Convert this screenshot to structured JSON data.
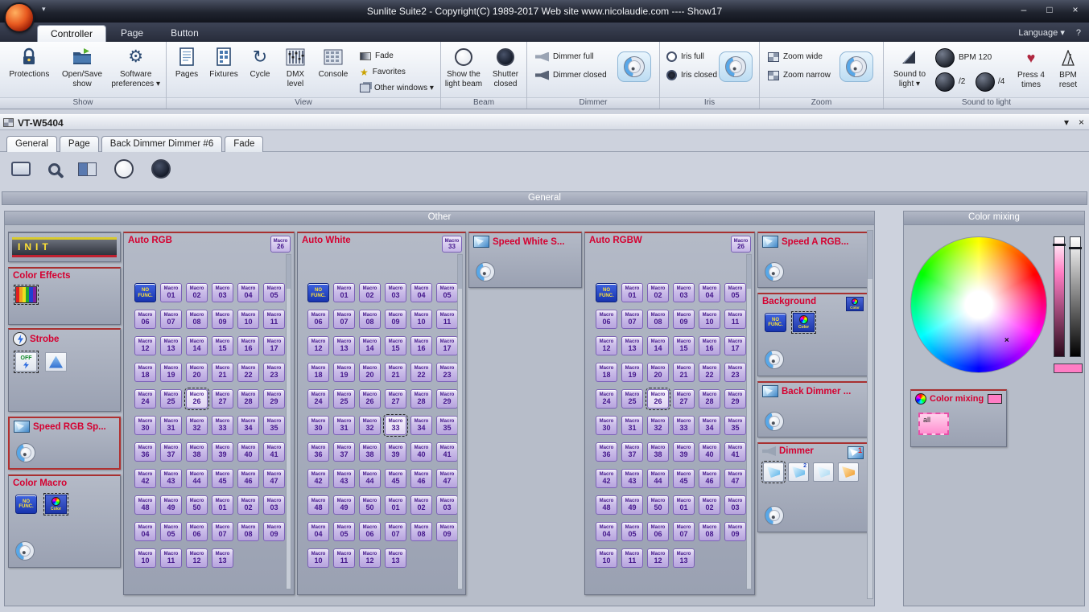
{
  "title_bar": {
    "title": "Sunlite Suite2 - Copyright(C) 1989-2017    Web site www.nicolaudie.com ---- Show17",
    "caret": "▾",
    "controls": {
      "minimize": "–",
      "maximize": "□",
      "close": "×"
    }
  },
  "menu": {
    "tabs": [
      {
        "label": "Controller",
        "active": true
      },
      {
        "label": "Page",
        "active": false
      },
      {
        "label": "Button",
        "active": false
      }
    ],
    "language_label": "Language",
    "language_caret": "▾",
    "help_label": "?"
  },
  "ribbon": {
    "caret": "▾",
    "show": {
      "label": "Show",
      "items": [
        "Protections",
        "Open/Save show",
        "Software preferences"
      ]
    },
    "view": {
      "label": "View",
      "big_items": [
        "Pages",
        "Fixtures",
        "Cycle",
        "DMX level",
        "Console"
      ],
      "stack_items": [
        "Fade",
        "Favorites",
        "Other windows"
      ]
    },
    "beam": {
      "label": "Beam",
      "items": [
        "Show the light beam",
        "Shutter closed"
      ]
    },
    "dimmer": {
      "label": "Dimmer",
      "items": [
        "Dimmer full",
        "Dimmer closed"
      ]
    },
    "iris": {
      "label": "Iris",
      "items": [
        "Iris full",
        "Iris closed"
      ]
    },
    "zoom": {
      "label": "Zoom",
      "items": [
        "Zoom wide",
        "Zoom narrow"
      ]
    },
    "sound": {
      "label": "Sound to light",
      "button": "Sound to light",
      "bpm": "BPM 120",
      "div2": "/2",
      "div4": "/4",
      "press": "Press 4 times",
      "reset": "BPM reset"
    }
  },
  "window": {
    "title": "VT-W5404",
    "controls": {
      "collapse": "▾",
      "close": "×"
    },
    "tabs": [
      "General",
      "Page",
      "Back Dimmer Dimmer #6",
      "Fade"
    ],
    "section_header": "General"
  },
  "other_panel": {
    "title": "Other",
    "init_group": {
      "title": "INIT"
    },
    "color_effects_group": {
      "title": "Color Effects"
    },
    "strobe_group": {
      "title": "Strobe",
      "off_label": "OFF"
    },
    "speed_rgb_group": {
      "title": "Speed RGB Sp..."
    },
    "color_macro_group": {
      "title": "Color Macro",
      "no_func_label": "NO FUNC.",
      "color_label": "Color"
    },
    "speed_white_group": {
      "title": "Speed White S..."
    },
    "speed_a_group": {
      "title": "Speed A RGB..."
    },
    "background_group": {
      "title": "Background",
      "badge": "Color",
      "no_func_label": "NO FUNC.",
      "color_label": "Color"
    },
    "back_dimmer_group": {
      "title": "Back Dimmer ..."
    },
    "dimmer_group": {
      "title": "Dimmer",
      "badge": "1",
      "beam2_label": "2"
    },
    "macro_labels": [
      "NO FUNC.",
      "Macro 01",
      "Macro 02",
      "Macro 03",
      "Macro 04",
      "Macro 05",
      "Macro 06",
      "Macro 07",
      "Macro 08",
      "Macro 09",
      "Macro 10",
      "Macro 11",
      "Macro 12",
      "Macro 13",
      "Macro 14",
      "Macro 15",
      "Macro 16",
      "Macro 17",
      "Macro 18",
      "Macro 19",
      "Macro 20",
      "Macro 21",
      "Macro 22",
      "Macro 23",
      "Macro 24",
      "Macro 25",
      "Macro 26",
      "Macro 27",
      "Macro 28",
      "Macro 29",
      "Macro 30",
      "Macro 31",
      "Macro 32",
      "Macro 33",
      "Macro 34",
      "Macro 35",
      "Macro 36",
      "Macro 37",
      "Macro 38",
      "Macro 39",
      "Macro 40",
      "Macro 41",
      "Macro 42",
      "Macro 43",
      "Macro 44",
      "Macro 45",
      "Macro 46",
      "Macro 47",
      "Macro 48",
      "Macro 49",
      "Macro 50",
      "Macro 01",
      "Macro 02",
      "Macro 03",
      "Macro 04",
      "Macro 05",
      "Macro 06",
      "Macro 07",
      "Macro 08",
      "Macro 09",
      "Macro 10",
      "Macro 11",
      "Macro 12",
      "Macro 13"
    ],
    "macro_groups": [
      {
        "title": "Auto RGB",
        "badge": "Macro 26",
        "selected_index": 26
      },
      {
        "title": "Auto White",
        "badge": "Macro 33",
        "selected_index": 33
      },
      {
        "title": "Auto RGBW",
        "badge": "Macro 26",
        "selected_index": 26
      }
    ]
  },
  "color_mixing_panel": {
    "title": "Color mixing",
    "swatch_color": "#ff7dc4",
    "sub_group": {
      "title": "Color mixing",
      "all_label": "all"
    }
  }
}
